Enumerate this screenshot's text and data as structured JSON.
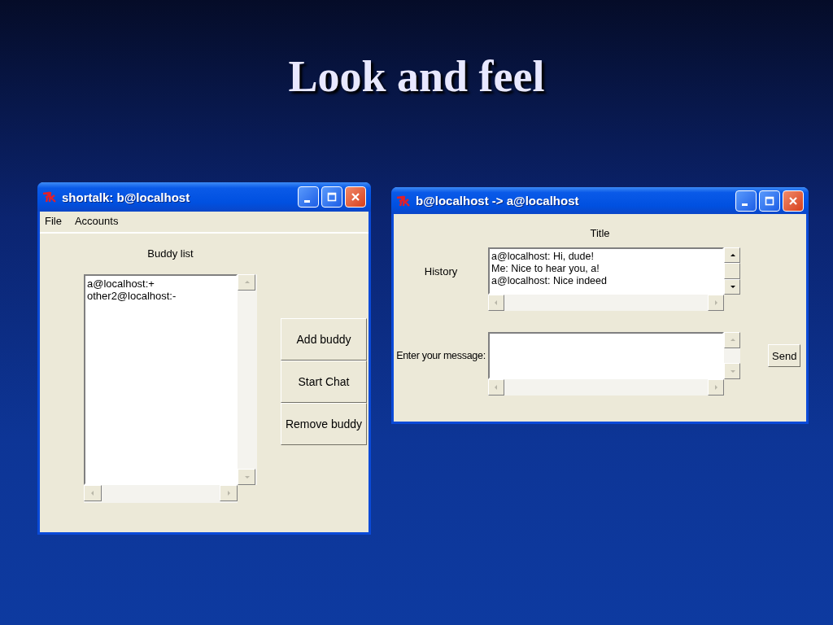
{
  "slide": {
    "title": "Look and feel"
  },
  "buddy_window": {
    "title": "shortalk: b@localhost",
    "menu": [
      "File",
      "Accounts"
    ],
    "list_label": "Buddy list",
    "buddy_list": {
      "items": [
        "a@localhost:+",
        "other2@localhost:-"
      ],
      "vscroll_disabled": true,
      "hscroll_disabled": true
    },
    "buttons": [
      "Add buddy",
      "Start Chat",
      "Remove buddy"
    ]
  },
  "chat_window": {
    "title": "b@localhost -> a@localhost",
    "heading": "Title",
    "history_label": "History",
    "history": {
      "lines": [
        "a@localhost: Hi, dude!",
        "Me: Nice to hear you, a!",
        "a@localhost: Nice indeed"
      ],
      "vscroll_disabled": false,
      "hscroll_disabled": true
    },
    "message_label": "Enter your message:",
    "message": {
      "vscroll_disabled": true,
      "hscroll_disabled": true
    },
    "send_button": "Send"
  }
}
